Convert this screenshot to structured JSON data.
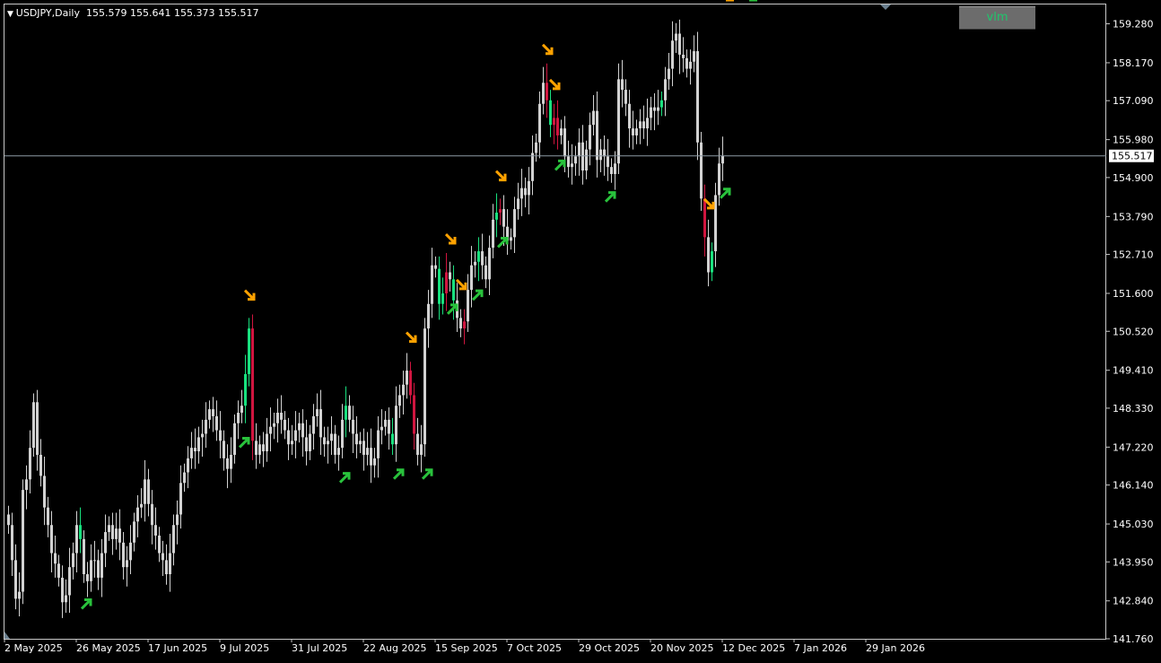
{
  "header": {
    "menu_icon": "triangle-down-icon",
    "symbol_label": "USDJPY,Daily",
    "ohlc_values": "155.579 155.641 155.373 155.517"
  },
  "indicator_button": {
    "label": "vlm"
  },
  "price_marker": {
    "label": "155.517"
  },
  "colors": {
    "background": "#000000",
    "frame": "#c8c8c8",
    "candle_neutral": "#d2d2d2",
    "candle_bull_signal": "#18e07e",
    "candle_bear_signal": "#d0153f",
    "arrow_up": "#29c23c",
    "arrow_down": "#ffa200",
    "current_price_line": "#8e9aa6"
  },
  "chart_data": {
    "type": "candlestick",
    "symbol": "USDJPY",
    "timeframe": "Daily",
    "ylim": [
      141.76,
      159.83
    ],
    "y_ticks": [
      "159.280",
      "158.170",
      "157.090",
      "155.980",
      "154.900",
      "153.790",
      "152.710",
      "151.600",
      "150.520",
      "149.410",
      "148.330",
      "147.220",
      "146.140",
      "145.030",
      "143.950",
      "142.840",
      "141.760"
    ],
    "x_labels": [
      "2 May 2025",
      "26 May 2025",
      "17 Jun 2025",
      "9 Jul 2025",
      "31 Jul 2025",
      "22 Aug 2025",
      "15 Sep 2025",
      "7 Oct 2025",
      "29 Oct 2025",
      "20 Nov 2025",
      "12 Dec 2025",
      "7 Jan 2026",
      "29 Jan 2026"
    ],
    "current_price": 155.517,
    "closes": [
      145.0,
      144.0,
      142.9,
      143.1,
      146.0,
      146.3,
      147.2,
      148.5,
      147.0,
      146.4,
      145.5,
      145.0,
      144.2,
      143.9,
      143.5,
      142.8,
      143.0,
      143.8,
      144.2,
      145.0,
      144.6,
      143.6,
      143.4,
      144.0,
      144.0,
      143.5,
      144.2,
      144.8,
      145.0,
      144.6,
      144.9,
      144.5,
      143.8,
      144.0,
      144.5,
      145.1,
      145.5,
      145.6,
      146.3,
      145.6,
      145.0,
      144.7,
      144.2,
      144.0,
      143.6,
      144.2,
      145.0,
      145.3,
      146.2,
      146.5,
      146.9,
      147.2,
      147.1,
      147.5,
      147.6,
      148.0,
      148.3,
      148.1,
      147.7,
      147.4,
      146.9,
      146.6,
      147.0,
      147.9,
      148.2,
      148.4,
      149.3,
      150.6,
      147.4,
      147.0,
      147.3,
      147.1,
      147.6,
      147.8,
      147.9,
      148.2,
      148.0,
      147.7,
      147.3,
      147.4,
      147.7,
      147.9,
      147.5,
      147.1,
      147.6,
      148.1,
      148.3,
      147.5,
      147.3,
      147.4,
      147.6,
      147.0,
      147.2,
      148.0,
      148.4,
      148.0,
      147.6,
      147.3,
      147.4,
      147.0,
      147.2,
      146.7,
      146.9,
      147.7,
      147.8,
      148.0,
      147.6,
      147.3,
      148.4,
      148.7,
      149.0,
      149.4,
      148.7,
      147.6,
      147.0,
      147.3,
      150.6,
      151.3,
      152.4,
      152.3,
      151.3,
      151.6,
      152.2,
      152.0,
      151.4,
      150.9,
      150.6,
      150.8,
      151.7,
      152.4,
      152.5,
      152.8,
      152.4,
      152.0,
      152.9,
      153.7,
      153.9,
      154.0,
      153.5,
      153.1,
      153.2,
      154.0,
      154.3,
      154.6,
      154.4,
      154.8,
      155.6,
      155.9,
      157.0,
      157.6,
      157.1,
      156.4,
      156.6,
      156.1,
      156.3,
      155.5,
      155.2,
      155.3,
      155.5,
      155.9,
      155.1,
      155.7,
      156.4,
      156.8,
      155.4,
      155.7,
      155.5,
      155.2,
      155.0,
      155.3,
      157.7,
      157.4,
      157.0,
      156.3,
      156.1,
      156.3,
      156.5,
      156.3,
      156.6,
      156.9,
      156.8,
      156.9,
      157.1,
      157.7,
      158.0,
      158.8,
      159.0,
      158.4,
      158.3,
      158.0,
      158.2,
      158.5,
      155.9,
      154.3,
      153.2,
      152.2,
      152.8,
      154.4,
      155.3,
      155.517
    ],
    "signal_candles": {
      "bull": [
        20,
        66,
        67,
        94,
        107,
        120,
        121,
        124,
        131,
        136,
        151,
        153,
        182,
        196,
        205,
        206
      ],
      "bear": [
        68,
        112,
        113,
        122,
        127,
        137,
        150,
        152,
        153,
        194,
        201,
        203
      ]
    },
    "arrows_up": [
      21,
      65,
      93,
      108,
      116,
      123,
      130,
      137,
      153,
      167,
      199,
      207
    ],
    "arrows_down": [
      67,
      112,
      123,
      126,
      137,
      150,
      152,
      195,
      201
    ]
  }
}
